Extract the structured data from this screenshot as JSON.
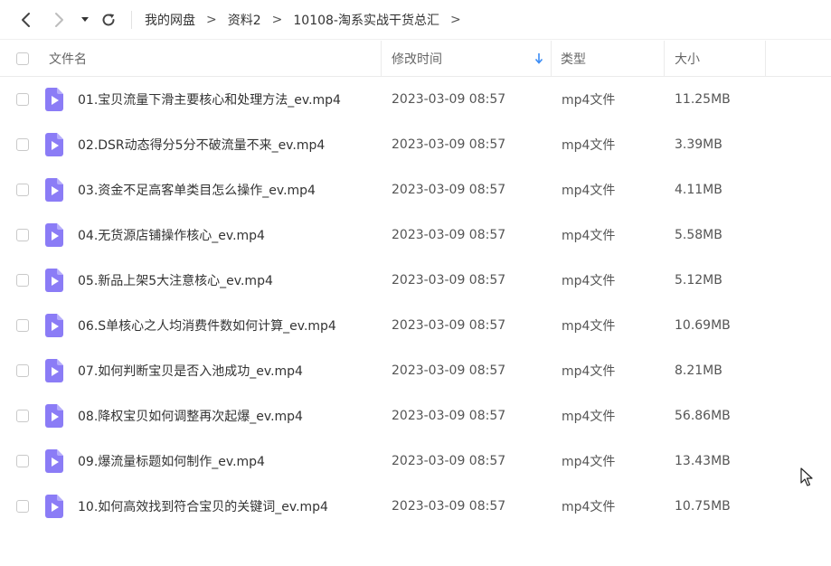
{
  "nav": {
    "back_icon": "chevron-left-icon",
    "forward_icon": "chevron-right-icon",
    "dropdown_icon": "caret-down-icon",
    "refresh_icon": "refresh-icon"
  },
  "breadcrumb": {
    "items": [
      "我的网盘",
      "资料2",
      "10108-淘系实战干货总汇"
    ],
    "separator": ">"
  },
  "table": {
    "headers": {
      "name": "文件名",
      "mtime": "修改时间",
      "type": "类型",
      "size": "大小"
    },
    "sort": {
      "column": "mtime",
      "direction": "desc",
      "icon": "arrow-down-icon"
    },
    "rows": [
      {
        "name": "01.宝贝流量下滑主要核心和处理方法_ev.mp4",
        "mtime": "2023-03-09 08:57",
        "type": "mp4文件",
        "size": "11.25MB"
      },
      {
        "name": "02.DSR动态得分5分不破流量不来_ev.mp4",
        "mtime": "2023-03-09 08:57",
        "type": "mp4文件",
        "size": "3.39MB"
      },
      {
        "name": "03.资金不足高客单类目怎么操作_ev.mp4",
        "mtime": "2023-03-09 08:57",
        "type": "mp4文件",
        "size": "4.11MB"
      },
      {
        "name": "04.无货源店铺操作核心_ev.mp4",
        "mtime": "2023-03-09 08:57",
        "type": "mp4文件",
        "size": "5.58MB"
      },
      {
        "name": "05.新品上架5大注意核心_ev.mp4",
        "mtime": "2023-03-09 08:57",
        "type": "mp4文件",
        "size": "5.12MB"
      },
      {
        "name": "06.S单核心之人均消费件数如何计算_ev.mp4",
        "mtime": "2023-03-09 08:57",
        "type": "mp4文件",
        "size": "10.69MB"
      },
      {
        "name": "07.如何判断宝贝是否入池成功_ev.mp4",
        "mtime": "2023-03-09 08:57",
        "type": "mp4文件",
        "size": "8.21MB"
      },
      {
        "name": "08.降权宝贝如何调整再次起爆_ev.mp4",
        "mtime": "2023-03-09 08:57",
        "type": "mp4文件",
        "size": "56.86MB"
      },
      {
        "name": "09.爆流量标题如何制作_ev.mp4",
        "mtime": "2023-03-09 08:57",
        "type": "mp4文件",
        "size": "13.43MB"
      },
      {
        "name": "10.如何高效找到符合宝贝的关键词_ev.mp4",
        "mtime": "2023-03-09 08:57",
        "type": "mp4文件",
        "size": "10.75MB"
      }
    ]
  },
  "colors": {
    "video_icon": "#8b7cf6",
    "video_icon_fold": "#b6adfb",
    "sort_arrow": "#3b8cf5"
  }
}
